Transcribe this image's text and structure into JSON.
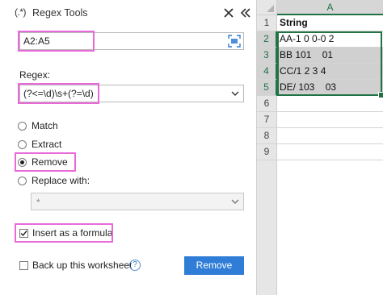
{
  "panel": {
    "title_icon": "(.*)",
    "title": "Regex Tools",
    "close_icon": "close-icon",
    "collapse_icon": "double-chevron-left-icon"
  },
  "range": {
    "value": "A2:A5",
    "picker_icon": "range-select-icon"
  },
  "regex": {
    "label": "Regex:",
    "value": "(?<=\\d)\\s+(?=\\d)"
  },
  "options": {
    "match": "Match",
    "extract": "Extract",
    "remove": "Remove",
    "replace": "Replace with:",
    "selected": "Remove"
  },
  "replace_select": {
    "value": "*"
  },
  "insert_formula": {
    "label": "Insert as a formula",
    "checked": true
  },
  "backup": {
    "label": "Back up this worksheet",
    "checked": false,
    "help": "?"
  },
  "button": {
    "remove": "Remove"
  },
  "sheet": {
    "column": "A",
    "row_numbers": [
      "1",
      "2",
      "3",
      "4",
      "5",
      "6",
      "7",
      "8",
      "9"
    ],
    "cells": [
      "String",
      "AA-1 0 0-0 2",
      "BB 101    01",
      "CC/1 2 3 4",
      "DE/ 103    03",
      "",
      "",
      "",
      ""
    ]
  },
  "colors": {
    "accent": "#2f7dd7",
    "highlight": "#e86ad8",
    "excel_green": "#217346"
  }
}
